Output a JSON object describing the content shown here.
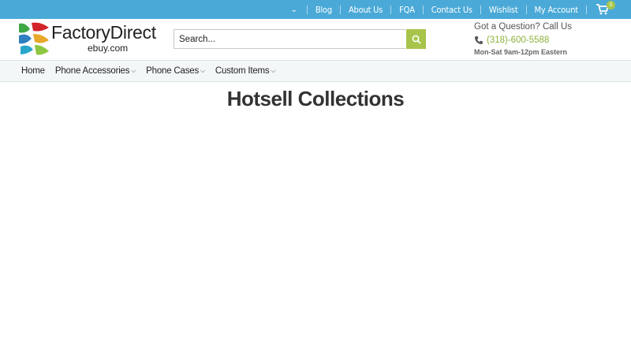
{
  "topbar": {
    "links": [
      "Blog",
      "About Us",
      "FQA",
      "Contact Us",
      "Wishlist",
      "My Account"
    ],
    "cart_count": "0"
  },
  "logo": {
    "name": "FactoryDirect",
    "sub": "ebuy.com"
  },
  "search": {
    "placeholder": "Search..."
  },
  "contact": {
    "question": "Got a Question? Call Us",
    "phone": "(318)-600-5588",
    "hours": "Mon-Sat 9am-12pm Eastern"
  },
  "nav": {
    "items": [
      "Home",
      "Phone Accessories",
      "Phone Cases",
      "Custom Items"
    ]
  },
  "page": {
    "title": "Hotsell Collections"
  },
  "colors": {
    "topbar": "#4aa9d7",
    "accent": "#a8c44a"
  }
}
